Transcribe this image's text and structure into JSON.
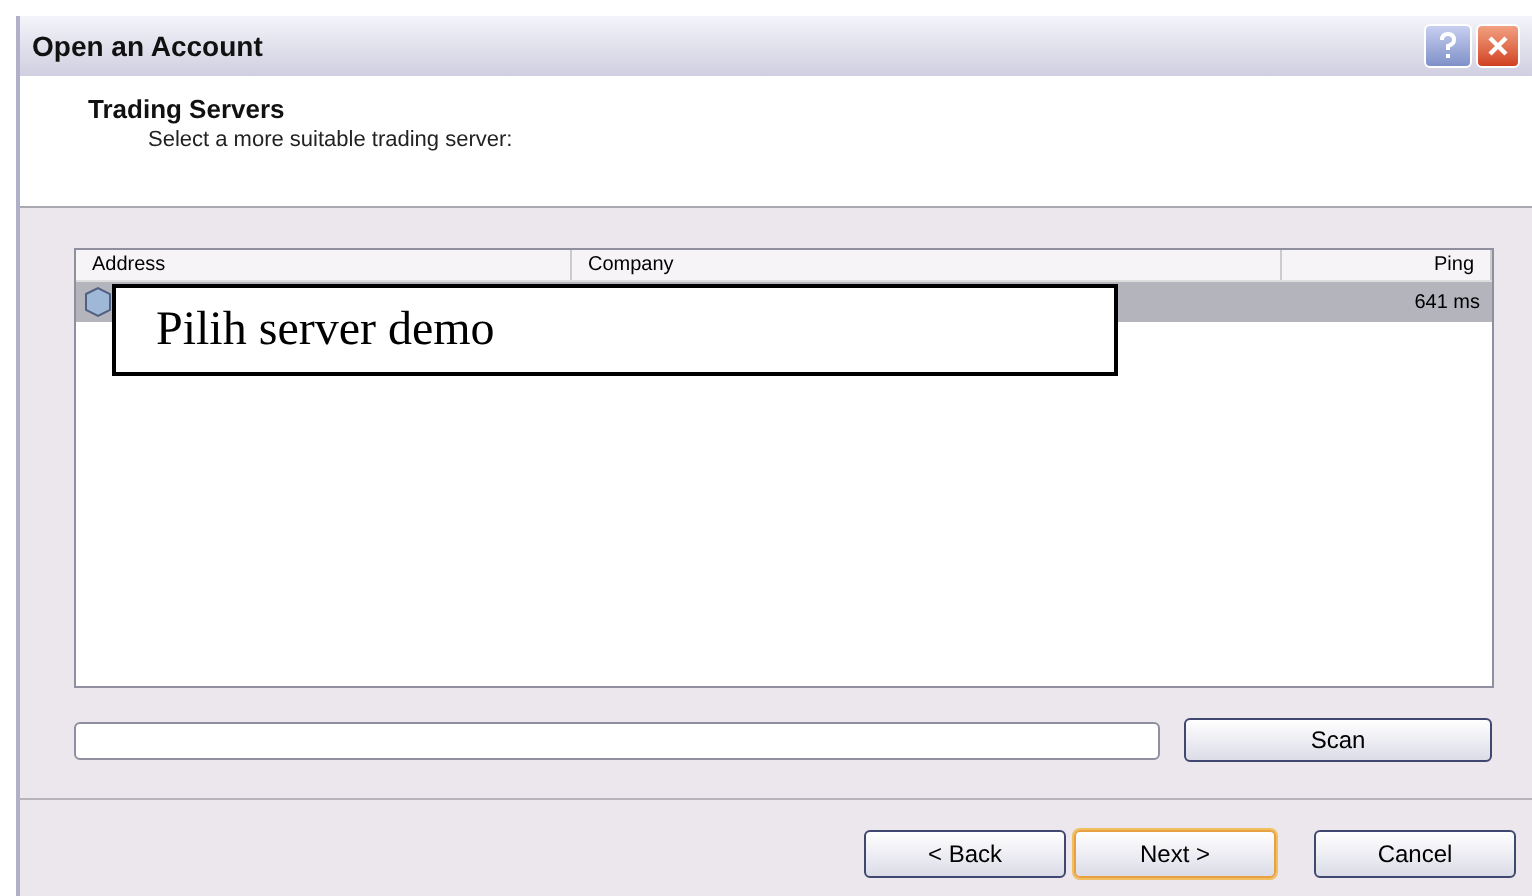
{
  "window": {
    "title": "Open an Account"
  },
  "header": {
    "title": "Trading Servers",
    "subtitle": "Select a more suitable trading server:"
  },
  "table": {
    "columns": [
      "Address",
      "Company",
      "Ping"
    ],
    "rows": [
      {
        "ping": "641 ms",
        "selected": true
      }
    ]
  },
  "scan_progress": {
    "level": 0
  },
  "scan_button": "Scan",
  "buttons": [
    {
      "label": "< Back",
      "default": false
    },
    {
      "label": "Next >",
      "default": true
    },
    {
      "label": "Cancel",
      "default": false
    }
  ],
  "annotation": {
    "text": "Pilih server demo"
  }
}
